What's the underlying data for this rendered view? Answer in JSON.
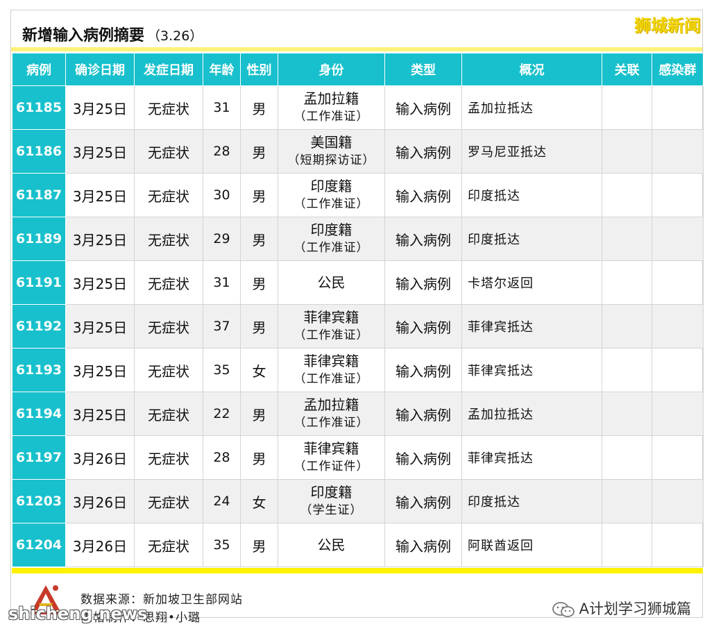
{
  "header": {
    "title": "新增输入病例摘要",
    "date": "（3.26）",
    "brand": "狮城新闻"
  },
  "table": {
    "columns": [
      "病例",
      "确诊日期",
      "发症日期",
      "年龄",
      "性别",
      "身份",
      "类型",
      "概况",
      "关联",
      "感染群"
    ],
    "rows": [
      {
        "case": "61185",
        "confirm": "3月25日",
        "onset": "无症状",
        "age": "31",
        "sex": "男",
        "id_main": "孟加拉籍",
        "id_sub": "（工作准证）",
        "type": "输入病例",
        "summary": "孟加拉抵达",
        "link": "",
        "cluster": ""
      },
      {
        "case": "61186",
        "confirm": "3月25日",
        "onset": "无症状",
        "age": "28",
        "sex": "男",
        "id_main": "美国籍",
        "id_sub": "（短期探访证）",
        "type": "输入病例",
        "summary": "罗马尼亚抵达",
        "link": "",
        "cluster": ""
      },
      {
        "case": "61187",
        "confirm": "3月25日",
        "onset": "无症状",
        "age": "30",
        "sex": "男",
        "id_main": "印度籍",
        "id_sub": "（工作准证）",
        "type": "输入病例",
        "summary": "印度抵达",
        "link": "",
        "cluster": ""
      },
      {
        "case": "61189",
        "confirm": "3月25日",
        "onset": "无症状",
        "age": "29",
        "sex": "男",
        "id_main": "印度籍",
        "id_sub": "（工作准证）",
        "type": "输入病例",
        "summary": "印度抵达",
        "link": "",
        "cluster": ""
      },
      {
        "case": "61191",
        "confirm": "3月25日",
        "onset": "无症状",
        "age": "31",
        "sex": "男",
        "id_main": "公民",
        "id_sub": "",
        "type": "输入病例",
        "summary": "卡塔尔返回",
        "link": "",
        "cluster": ""
      },
      {
        "case": "61192",
        "confirm": "3月25日",
        "onset": "无症状",
        "age": "37",
        "sex": "男",
        "id_main": "菲律宾籍",
        "id_sub": "（工作准证）",
        "type": "输入病例",
        "summary": "菲律宾抵达",
        "link": "",
        "cluster": ""
      },
      {
        "case": "61193",
        "confirm": "3月25日",
        "onset": "无症状",
        "age": "35",
        "sex": "女",
        "id_main": "菲律宾籍",
        "id_sub": "（工作准证）",
        "type": "输入病例",
        "summary": "菲律宾抵达",
        "link": "",
        "cluster": ""
      },
      {
        "case": "61194",
        "confirm": "3月25日",
        "onset": "无症状",
        "age": "22",
        "sex": "男",
        "id_main": "孟加拉籍",
        "id_sub": "（工作准证）",
        "type": "输入病例",
        "summary": "孟加拉抵达",
        "link": "",
        "cluster": ""
      },
      {
        "case": "61197",
        "confirm": "3月26日",
        "onset": "无症状",
        "age": "28",
        "sex": "男",
        "id_main": "菲律宾籍",
        "id_sub": "（工作证件）",
        "type": "输入病例",
        "summary": "菲律宾抵达",
        "link": "",
        "cluster": ""
      },
      {
        "case": "61203",
        "confirm": "3月26日",
        "onset": "无症状",
        "age": "24",
        "sex": "女",
        "id_main": "印度籍",
        "id_sub": "（学生证）",
        "type": "输入病例",
        "summary": "印度抵达",
        "link": "",
        "cluster": ""
      },
      {
        "case": "61204",
        "confirm": "3月26日",
        "onset": "无症状",
        "age": "35",
        "sex": "男",
        "id_main": "公民",
        "id_sub": "",
        "type": "输入病例",
        "summary": "阿联酋返回",
        "link": "",
        "cluster": ""
      }
    ]
  },
  "footer": {
    "source": "数据来源：新加坡卫生部网站",
    "maker": "表格制作：思翔•小璐",
    "wechat": "A计划学习狮城篇",
    "watermark": "shicheng.news"
  },
  "colors": {
    "header_bg": "#17c0cc",
    "accent_yellow": "#fff200",
    "brand_yellow": "#f2d500"
  }
}
